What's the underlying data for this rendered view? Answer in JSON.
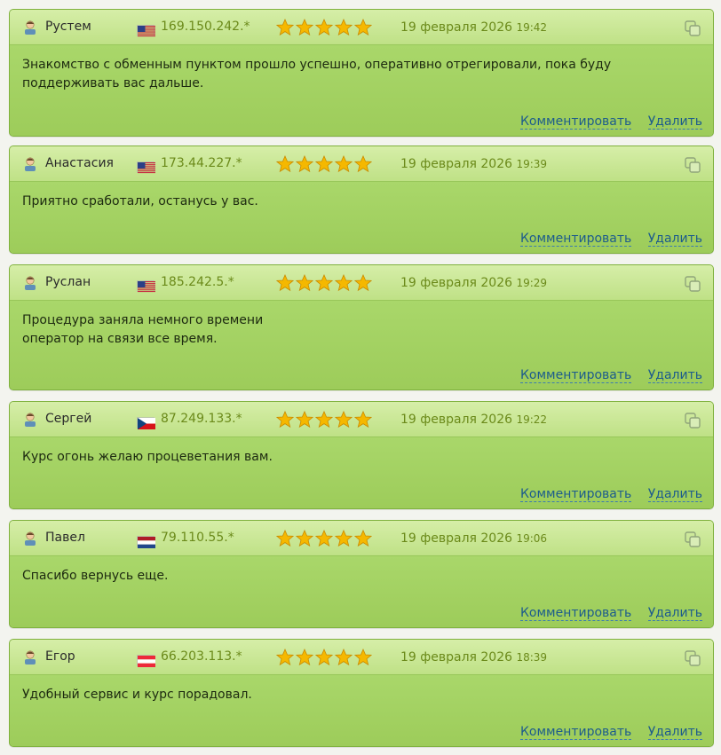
{
  "actions": {
    "comment_label": "Комментировать",
    "delete_label": "Удалить"
  },
  "reviews": [
    {
      "author": "Рустем",
      "flag": "us-flag-icon",
      "ip": "169.150.242.*",
      "rating": 5,
      "date": "19 февраля 2026",
      "time": "19:42",
      "text": "Знакомство с обменным пунктом прошло успешно, оперативно отрегировали, пока буду поддерживать вас дальше."
    },
    {
      "author": "Анастасия",
      "flag": "us-flag-icon",
      "ip": "173.44.227.*",
      "rating": 5,
      "date": "19 февраля 2026",
      "time": "19:39",
      "text": "Приятно сработали, останусь у вас."
    },
    {
      "author": "Руслан",
      "flag": "us-flag-icon",
      "ip": "185.242.5.*",
      "rating": 5,
      "date": "19 февраля 2026",
      "time": "19:29",
      "text": "Процедура заняла немного времени\nоператор на связи все время."
    },
    {
      "author": "Сергей",
      "flag": "cz-flag-icon",
      "ip": "87.249.133.*",
      "rating": 5,
      "date": "19 февраля 2026",
      "time": "19:22",
      "text": "Курс огонь желаю процеветания вам."
    },
    {
      "author": "Павел",
      "flag": "nl-flag-icon",
      "ip": "79.110.55.*",
      "rating": 5,
      "date": "19 февраля 2026",
      "time": "19:06",
      "text": "Спасибо вернусь еще."
    },
    {
      "author": "Егор",
      "flag": "at-flag-icon",
      "ip": "66.203.113.*",
      "rating": 5,
      "date": "19 февраля 2026",
      "time": "18:39",
      "text": "Удобный сервис и курс порадовал."
    }
  ],
  "colors": {
    "star": "#f5b800",
    "link": "#1d5c8c",
    "ip_date": "#6b8a1a"
  }
}
